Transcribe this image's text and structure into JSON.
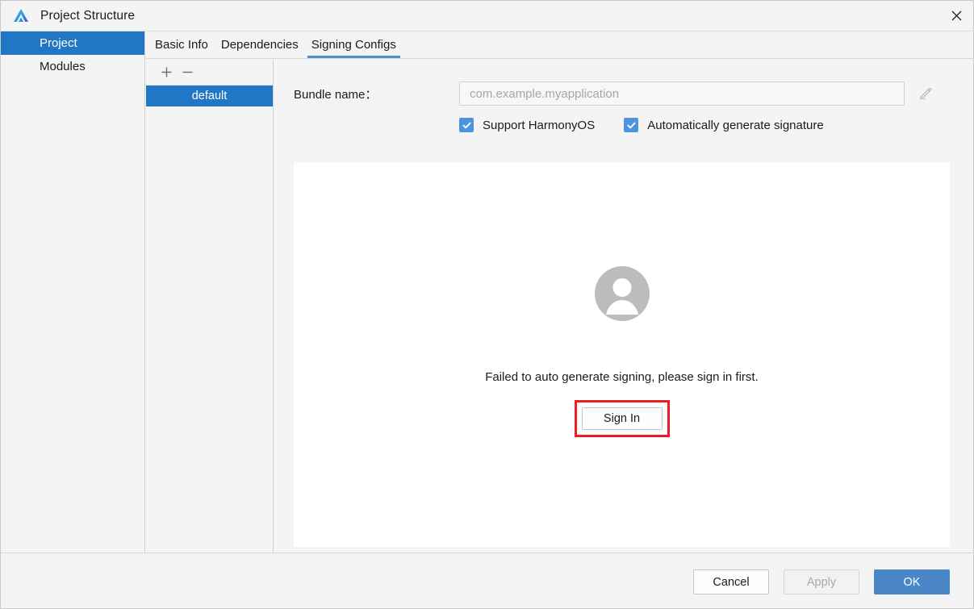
{
  "window": {
    "title": "Project Structure",
    "app_icon": "deveco-logo-icon",
    "close_icon": "close-icon"
  },
  "sidebar": {
    "items": [
      {
        "label": "Project",
        "selected": true
      },
      {
        "label": "Modules",
        "selected": false
      }
    ]
  },
  "tabs": [
    {
      "label": "Basic Info",
      "active": false
    },
    {
      "label": "Dependencies",
      "active": false
    },
    {
      "label": "Signing Configs",
      "active": true
    }
  ],
  "config_list": {
    "add_label": "+",
    "remove_label": "—",
    "items": [
      {
        "label": "default",
        "selected": true
      }
    ]
  },
  "form": {
    "bundle_name_label": "Bundle name：",
    "bundle_name_value": "",
    "bundle_name_placeholder": "com.example.myapplication",
    "edit_icon": "pencil-edit-icon",
    "checkboxes": [
      {
        "label": "Support HarmonyOS",
        "checked": true
      },
      {
        "label": "Automatically generate signature",
        "checked": true
      }
    ]
  },
  "signing_panel": {
    "avatar_icon": "user-avatar-placeholder-icon",
    "message": "Failed to auto generate signing, please sign in first.",
    "sign_in_label": "Sign In",
    "highlight_color": "#ee1c25"
  },
  "footer": {
    "cancel_label": "Cancel",
    "apply_label": "Apply",
    "ok_label": "OK"
  },
  "colors": {
    "accent": "#2277c4",
    "primary_button": "#4b87c7",
    "checkbox": "#4d93dd",
    "tab_underline": "#4a8fd4"
  }
}
